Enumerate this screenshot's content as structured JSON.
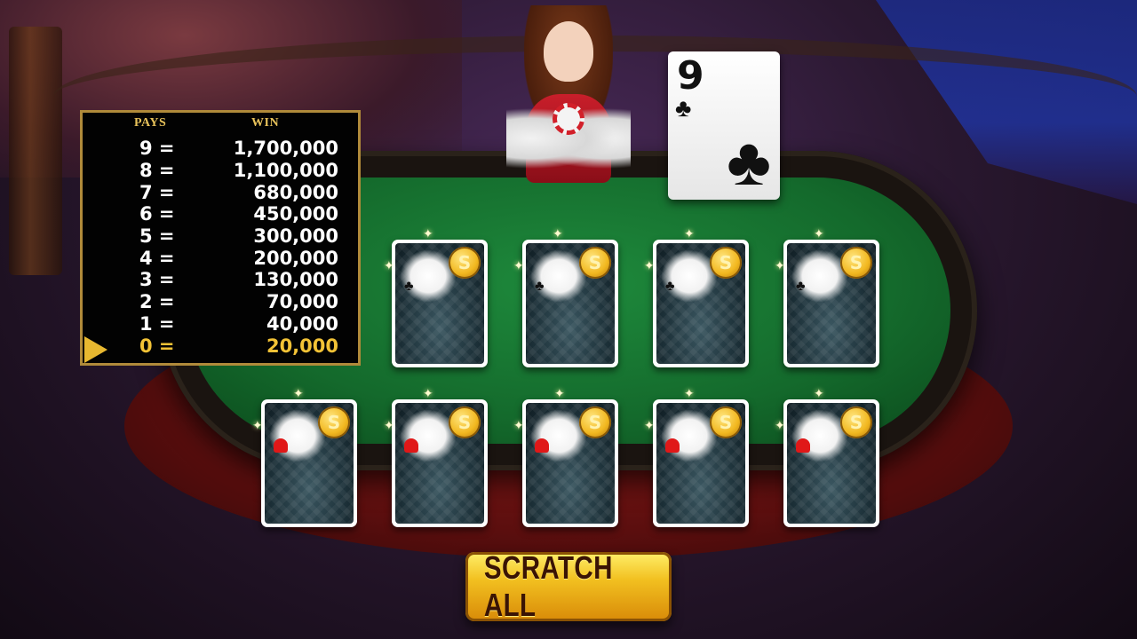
{
  "paytable": {
    "header_pays": "PAYS",
    "header_win": "WIN",
    "rows": [
      {
        "count": "9 =",
        "amount": "1,700,000"
      },
      {
        "count": "8 =",
        "amount": "1,100,000"
      },
      {
        "count": "7 =",
        "amount": "680,000"
      },
      {
        "count": "6 =",
        "amount": "450,000"
      },
      {
        "count": "5 =",
        "amount": "300,000"
      },
      {
        "count": "4 =",
        "amount": "200,000"
      },
      {
        "count": "3 =",
        "amount": "130,000"
      },
      {
        "count": "2 =",
        "amount": "70,000"
      },
      {
        "count": "1 =",
        "amount": "40,000"
      },
      {
        "count": "0 =",
        "amount": "20,000"
      }
    ],
    "active_row_index": 9,
    "active_color": "#f2c236"
  },
  "open_card": {
    "rank": "9",
    "suit_symbol": "♣"
  },
  "scratch_cards": {
    "coin_symbol": "S",
    "count": 9
  },
  "scratch_all_button": {
    "label": "SCRATCH ALL"
  },
  "colors": {
    "felt": "#146a2c",
    "table_rim": "#8a1a18",
    "button_gold": "#f2c020",
    "pays_border": "#b08a3a"
  }
}
